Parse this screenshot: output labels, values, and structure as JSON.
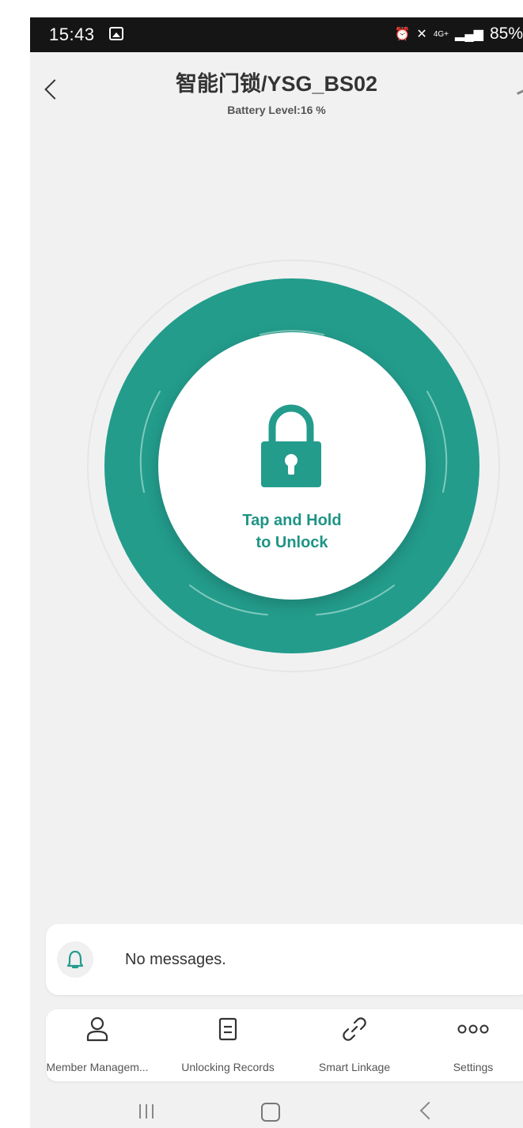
{
  "status_bar": {
    "time": "15:43",
    "network": "4G+",
    "battery": "85%"
  },
  "header": {
    "title": "智能门锁/YSG_BS02",
    "subtitle": "Battery Level:16 %"
  },
  "unlock": {
    "label_line1": "Tap and Hold",
    "label_line2": "to Unlock",
    "accent_color": "#239c8c"
  },
  "messages": {
    "text": "No messages."
  },
  "tabs": [
    {
      "label": "Member Managem...",
      "icon": "person-icon"
    },
    {
      "label": "Unlocking Records",
      "icon": "records-icon"
    },
    {
      "label": "Smart Linkage",
      "icon": "link-icon"
    },
    {
      "label": "Settings",
      "icon": "more-dots-icon"
    }
  ]
}
